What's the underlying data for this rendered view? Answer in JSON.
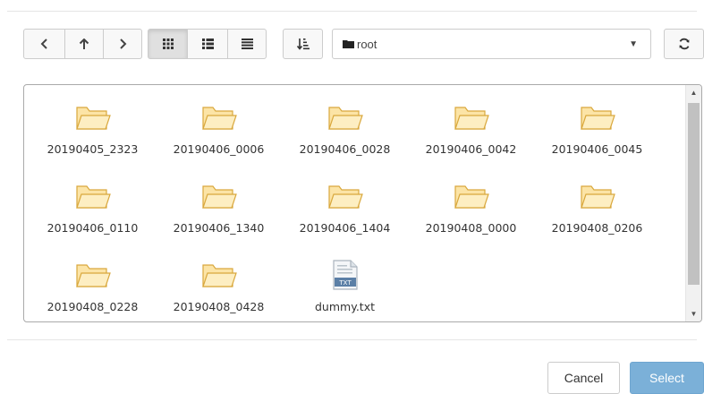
{
  "toolbar": {
    "back": "‹",
    "up": "↑",
    "forward": "›",
    "view_icons": "grid-view-icon",
    "view_list": "list-view-icon",
    "view_detail": "detail-view-icon",
    "sort": "sort-icon",
    "path": "root",
    "refresh": "refresh-icon"
  },
  "items": [
    {
      "name": "20190405_2323",
      "type": "folder"
    },
    {
      "name": "20190406_0006",
      "type": "folder"
    },
    {
      "name": "20190406_0028",
      "type": "folder"
    },
    {
      "name": "20190406_0042",
      "type": "folder"
    },
    {
      "name": "20190406_0045",
      "type": "folder"
    },
    {
      "name": "20190406_0110",
      "type": "folder"
    },
    {
      "name": "20190406_1340",
      "type": "folder"
    },
    {
      "name": "20190406_1404",
      "type": "folder"
    },
    {
      "name": "20190408_0000",
      "type": "folder"
    },
    {
      "name": "20190408_0206",
      "type": "folder"
    },
    {
      "name": "20190408_0228",
      "type": "folder"
    },
    {
      "name": "20190408_0428",
      "type": "folder"
    },
    {
      "name": "dummy.txt",
      "type": "txt",
      "badge": "TXT"
    }
  ],
  "footer": {
    "cancel_label": "Cancel",
    "select_label": "Select"
  },
  "colors": {
    "folder_fill": "#fce4a6",
    "folder_stroke": "#d9a83d",
    "select_bg": "#7bb0d8"
  }
}
